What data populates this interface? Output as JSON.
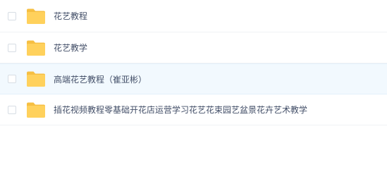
{
  "files": [
    {
      "name": "花艺教程",
      "icon": "folder-icon"
    },
    {
      "name": "花艺教学",
      "icon": "folder-icon"
    },
    {
      "name": "高端花艺教程（崔亚彬）",
      "icon": "folder-icon"
    },
    {
      "name": "插花视频教程零基础开花店运营学习花艺花束园艺盆景花卉艺术教学",
      "icon": "folder-icon"
    }
  ],
  "colors": {
    "folder": "#ffd15c",
    "folder_tab": "#f6bf42",
    "text": "#424e67",
    "row_hover": "#f2f9fe"
  }
}
